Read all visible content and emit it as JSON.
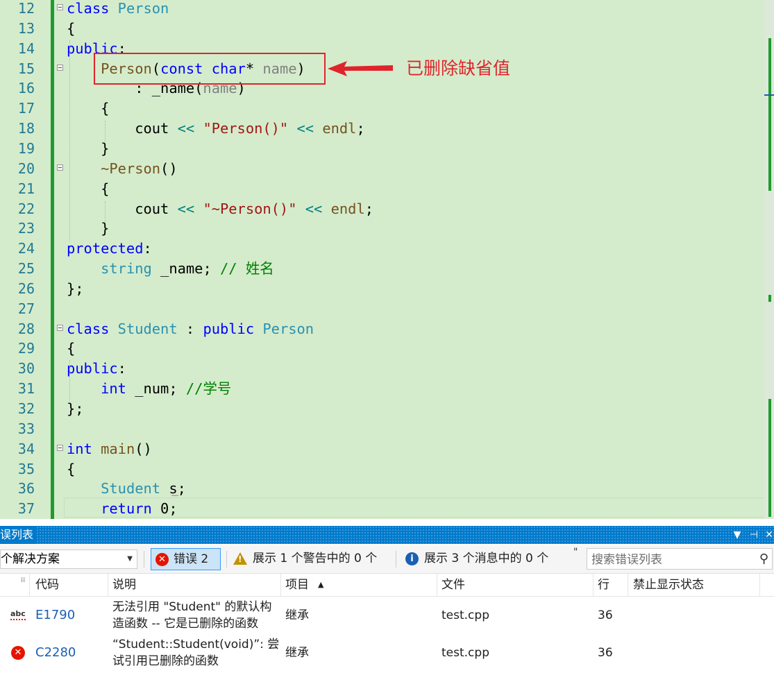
{
  "editor": {
    "lines": [
      {
        "n": "12",
        "html": "<span class=\"kw\">class</span> <span class=\"ty\">Person</span>"
      },
      {
        "n": "13",
        "html": "{"
      },
      {
        "n": "14",
        "html": "<span class=\"kw\">public</span>:"
      },
      {
        "n": "15",
        "html": "    <span class=\"fn\">Person</span>(<span class=\"kw\">const</span> <span class=\"kw\">char</span>* <span class=\"pm\">name</span>)"
      },
      {
        "n": "16",
        "html": "        : _name(<span class=\"pm\">name</span>)"
      },
      {
        "n": "17",
        "html": "    {"
      },
      {
        "n": "18",
        "html": "        cout <span class=\"op\">&lt;&lt;</span> <span class=\"str\">\"Person()\"</span> <span class=\"op\">&lt;&lt;</span> <span class=\"fn\">endl</span>;"
      },
      {
        "n": "19",
        "html": "    }"
      },
      {
        "n": "20",
        "html": "    <span class=\"fn\">~Person</span>()"
      },
      {
        "n": "21",
        "html": "    {"
      },
      {
        "n": "22",
        "html": "        cout <span class=\"op\">&lt;&lt;</span> <span class=\"str\">\"~Person()\"</span> <span class=\"op\">&lt;&lt;</span> <span class=\"fn\">endl</span>;"
      },
      {
        "n": "23",
        "html": "    }"
      },
      {
        "n": "24",
        "html": "<span class=\"kw\">protected</span>:"
      },
      {
        "n": "25",
        "html": "    <span class=\"ty\">string</span> _name; <span class=\"cm\">// 姓名</span>"
      },
      {
        "n": "26",
        "html": "};"
      },
      {
        "n": "27",
        "html": ""
      },
      {
        "n": "28",
        "html": "<span class=\"kw\">class</span> <span class=\"ty\">Student</span> : <span class=\"kw\">public</span> <span class=\"ty\">Person</span>"
      },
      {
        "n": "29",
        "html": "{"
      },
      {
        "n": "30",
        "html": "<span class=\"kw\">public</span>:"
      },
      {
        "n": "31",
        "html": "    <span class=\"kw\">int</span> _num; <span class=\"cm\">//学号</span>"
      },
      {
        "n": "32",
        "html": "};"
      },
      {
        "n": "33",
        "html": ""
      },
      {
        "n": "34",
        "html": "<span class=\"kw\">int</span> <span class=\"fn\">main</span>()"
      },
      {
        "n": "35",
        "html": "{"
      },
      {
        "n": "36",
        "html": "    <span class=\"ty\">Student</span> s;"
      },
      {
        "n": "37",
        "html": "    <span class=\"kw\">return</span> 0;"
      }
    ]
  },
  "annotation": {
    "text": "已删除缺省值",
    "color": "#e0242b"
  },
  "error_list": {
    "title": "误列表",
    "title_buttons": {
      "dropdown": "▼",
      "pin": "⊣",
      "close": "✕"
    },
    "scope": "个解决方案",
    "errors_label": "错误 2",
    "warnings_label": "展示 1 个警告中的 0 个",
    "messages_label": "展示 3 个消息中的 0 个",
    "more": "\"",
    "search_placeholder": "搜索错误列表",
    "columns": {
      "code": "代码",
      "description": "说明",
      "project": "项目",
      "file": "文件",
      "line": "行",
      "suppression": "禁止显示状态"
    },
    "rows": [
      {
        "code": "E1790",
        "desc1": "无法引用 \"Student\" 的默认构",
        "desc2": "造函数 -- 它是已删除的函数",
        "project": "继承",
        "file": "test.cpp",
        "line": "36"
      },
      {
        "code": "C2280",
        "desc1": "“Student::Student(void)”: 尝",
        "desc2": "试引用已删除的函数",
        "project": "继承",
        "file": "test.cpp",
        "line": "36"
      }
    ]
  },
  "colors": {
    "editor_bg": "#d4eccc",
    "accent": "#007acc",
    "error": "#e51400",
    "warning": "#c09300",
    "info": "#1a5fb4"
  },
  "icons": {
    "error": "error-icon",
    "warning": "warning-icon",
    "info": "info-icon",
    "search": "search-icon",
    "spell": "spell-check-icon"
  }
}
